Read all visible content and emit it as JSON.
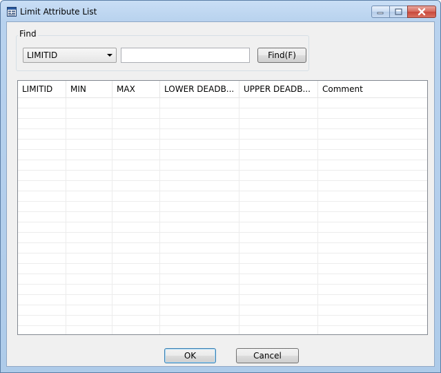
{
  "window": {
    "title": "Limit Attribute List"
  },
  "find": {
    "group_label": "Find",
    "field_selected": "LIMITID",
    "search_value": "",
    "search_placeholder": "",
    "button_label": "Find(F)"
  },
  "table": {
    "columns": [
      "LIMITID",
      "MIN",
      "MAX",
      "LOWER DEADB...",
      "UPPER DEADB...",
      "Comment"
    ],
    "rows": []
  },
  "footer": {
    "ok_label": "OK",
    "cancel_label": "Cancel"
  },
  "icons": {
    "app": "list-window-icon",
    "minimize": "minimize-icon",
    "maximize": "maximize-icon",
    "close": "close-icon",
    "dropdown": "chevron-down-icon"
  }
}
